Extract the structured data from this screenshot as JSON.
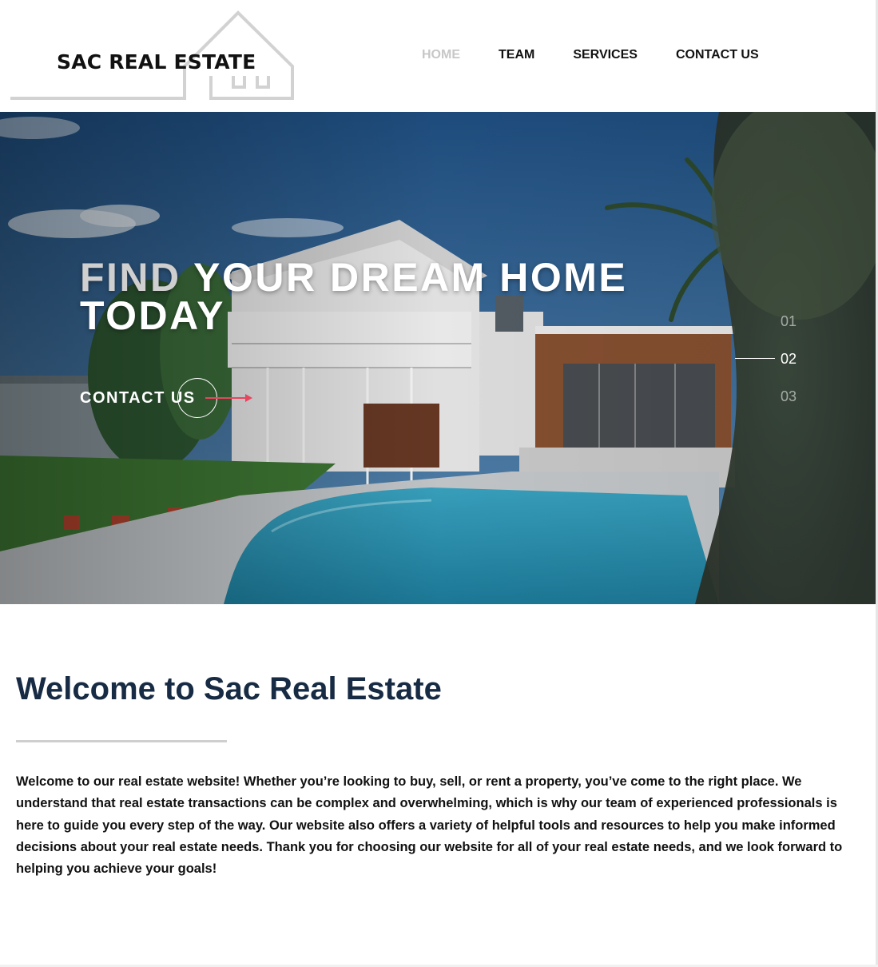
{
  "brand": {
    "logo_text": "SAC REAL ESTATE"
  },
  "nav": {
    "items": [
      {
        "label": "HOME",
        "active": true
      },
      {
        "label": "TEAM",
        "active": false
      },
      {
        "label": "SERVICES",
        "active": false
      },
      {
        "label": "CONTACT US",
        "active": false
      }
    ]
  },
  "hero": {
    "title_dim": "FIND",
    "title_rest": " YOUR DREAM HOME TODAY",
    "cta_label": "CONTACT US",
    "accent_color": "#e8455e",
    "slides": [
      "01",
      "02",
      "03"
    ],
    "active_slide": "02"
  },
  "welcome": {
    "title": "Welcome to Sac Real Estate",
    "body": "Welcome to our real estate website! Whether you’re looking to buy, sell, or rent a property, you’ve come to the right place. We understand that real estate transactions can be complex and overwhelming, which is why our team of experienced professionals is here to guide you every step of the way. Our website also offers a variety of helpful tools and resources to help you make informed decisions about your real estate needs. Thank you for choosing our website for all of your real estate needs, and we look forward to helping you achieve your goals!"
  },
  "colors": {
    "heading": "#172b44",
    "nav_active": "#c7c7c7",
    "logo_outline": "#d2d2d2"
  }
}
